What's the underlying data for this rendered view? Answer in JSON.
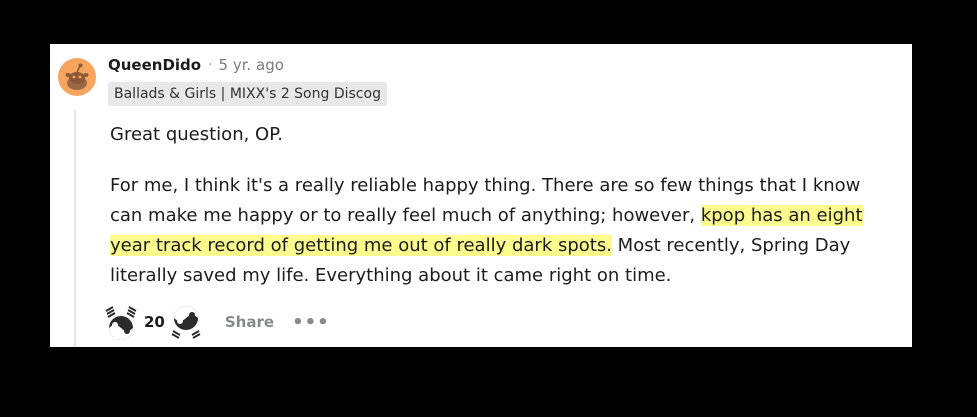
{
  "comment": {
    "username": "QueenDido",
    "separator": "·",
    "timestamp": "5 yr. ago",
    "flair": "Ballads & Girls | MIXX's 2 Song Discog",
    "paragraph1": "Great question, OP.",
    "paragraph2_before": "For me, I think it's a really reliable happy thing. There are so few things that I know can make me happy or to really feel much of anything; however, ",
    "paragraph2_highlight": "kpop has an eight year track record of getting me out of really dark spots.",
    "paragraph2_after": " Most recently, Spring Day literally saved my life. Everything about it came right on time.",
    "vote_count": "20",
    "share_label": "Share",
    "more_label": "•••"
  },
  "colors": {
    "avatar_bg": "#f7a45e",
    "highlight": "#fcfc8e",
    "flair_bg": "#e8e8e8",
    "muted_text": "#878a8c"
  },
  "icons": {
    "upvote": "upvote-icon",
    "downvote": "downvote-icon",
    "avatar": "snoo-avatar-icon"
  }
}
